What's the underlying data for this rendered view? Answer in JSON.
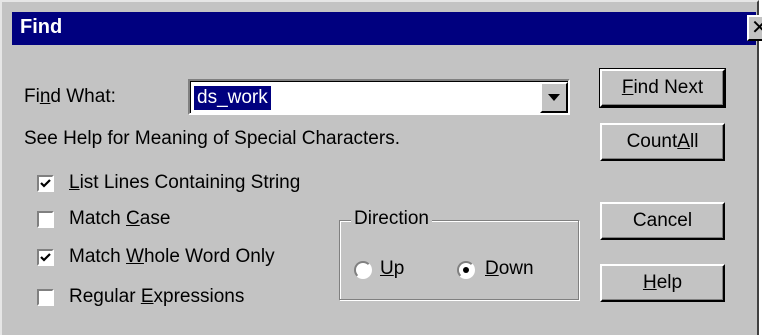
{
  "window": {
    "title": "Find"
  },
  "find_what": {
    "label_pre": "Fi",
    "label_key": "n",
    "label_post": "d What:",
    "value": "ds_work"
  },
  "help_text": "See Help for Meaning of Special Characters.",
  "options": {
    "list_lines": {
      "key": "L",
      "rest": "ist Lines Containing String",
      "checked": true
    },
    "match_case": {
      "pre": "Match ",
      "key": "C",
      "rest": "ase",
      "checked": false
    },
    "whole_word": {
      "pre": "Match ",
      "key": "W",
      "rest": "hole Word Only",
      "checked": true
    },
    "regex": {
      "pre": "Regular ",
      "key": "E",
      "rest": "xpressions",
      "checked": false
    }
  },
  "direction": {
    "title": "Direction",
    "up": {
      "key": "U",
      "rest": "p",
      "selected": false
    },
    "down": {
      "key": "D",
      "rest": "own",
      "selected": true
    }
  },
  "buttons": {
    "find_next": {
      "key": "F",
      "rest": "ind Next"
    },
    "count_all": {
      "pre": "Count ",
      "key": "A",
      "rest": "ll"
    },
    "cancel": {
      "label": "Cancel"
    },
    "help": {
      "key": "H",
      "rest": "elp"
    }
  }
}
